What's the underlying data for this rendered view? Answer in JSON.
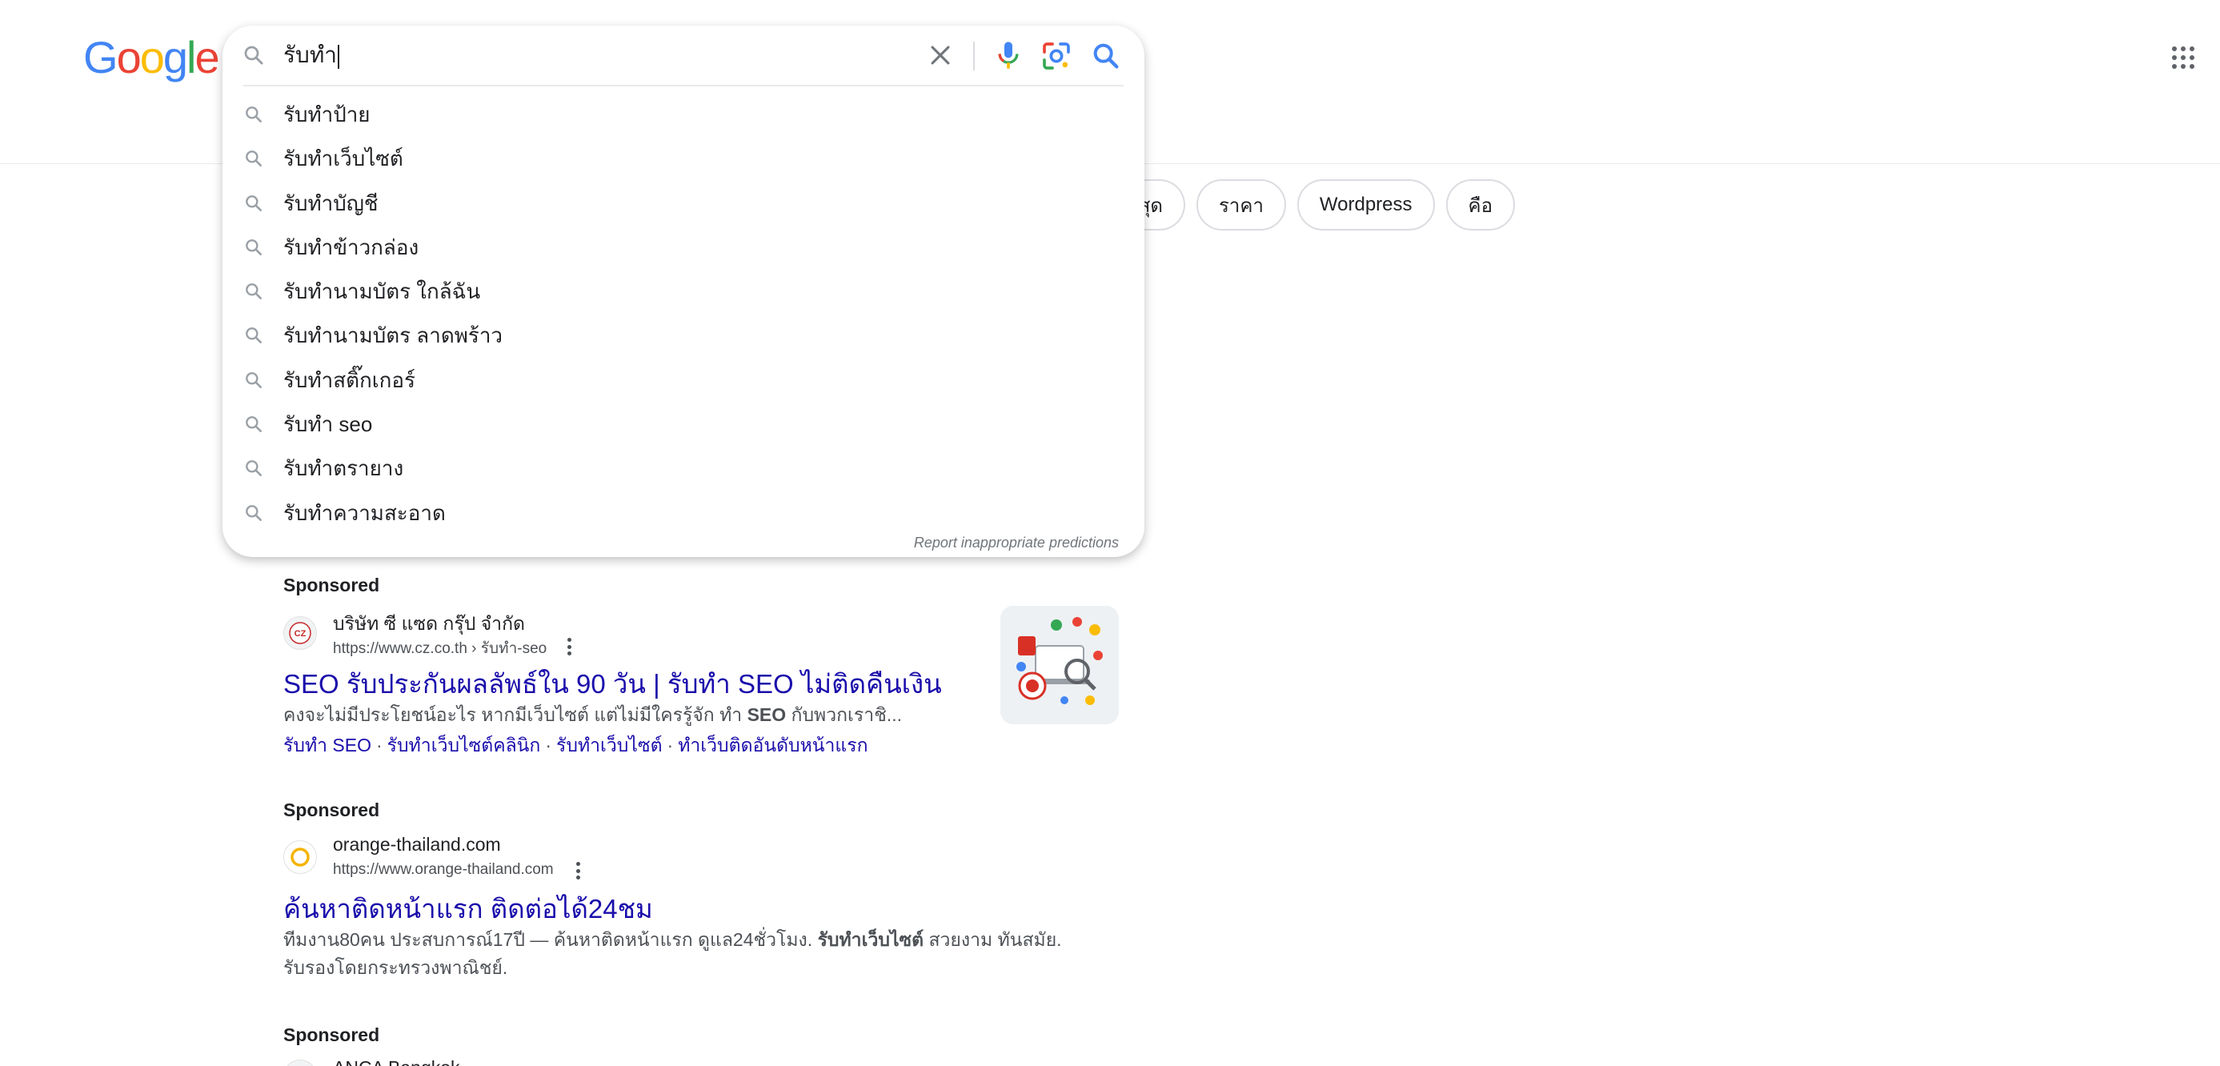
{
  "logo": {
    "text": "Google",
    "colors": [
      "#4285F4",
      "#EA4335",
      "#FBBC05",
      "#4285F4",
      "#34A853",
      "#EA4335"
    ]
  },
  "search": {
    "query": "รับทำ",
    "suggestions": [
      "รับทำป้าย",
      "รับทำเว็บไซต์",
      "รับทำบัญชี",
      "รับทำข้าวกล่อง",
      "รับทำนามบัตร ใกล้ฉัน",
      "รับทำนามบัตร ลาดพร้าว",
      "รับทำสติ๊กเกอร์",
      "รับทำ seo",
      "รับทำตรายาง",
      "รับทำความสะอาด"
    ],
    "report_text": "Report inappropriate predictions"
  },
  "chips": [
    "นสูงสุด",
    "ราคา",
    "Wordpress",
    "คือ"
  ],
  "ads": [
    {
      "sponsored_label": "Sponsored",
      "site_name": "บริษัท ซี แซด กรุ๊ป จำกัด",
      "url": "https://www.cz.co.th › รับทำ-seo",
      "favicon_text": "CZ",
      "title": "SEO รับประกันผลลัพธ์ใน 90 วัน | รับทำ SEO ไม่ติดคืนเงิน",
      "desc_pre": "คงจะไม่มีประโยชน์อะไร หากมีเว็บไซต์ แต่ไม่มีใครรู้จัก ทำ ",
      "desc_bold": "SEO",
      "desc_post": " กับพวกเราชิ...",
      "sitelinks": [
        "รับทำ SEO",
        "รับทำเว็บไซต์คลินิก",
        "รับทำเว็บไซต์",
        "ทำเว็บติดอันดับหน้าแรก"
      ],
      "sitelink_sep": "·"
    },
    {
      "sponsored_label": "Sponsored",
      "site_name": "orange-thailand.com",
      "url": "https://www.orange-thailand.com",
      "title": "ค้นหาติดหน้าแรก ติดต่อได้24ชม",
      "desc_line1_pre": "ทีมงาน80คน ประสบการณ์17ปี — ค้นหาติดหน้าแรก ดูแล24ชั่วโมง. ",
      "desc_line1_bold": "รับทำเว็บไซต์",
      "desc_line1_post": " สวยงาม ทันสมัย.",
      "desc_line2": "รับรองโดยกระทรวงพาณิชย์."
    },
    {
      "sponsored_label": "Sponsored",
      "site_name": "ANCA Bangkok"
    }
  ],
  "colors": {
    "link": "#1a0dab",
    "mic_blue": "#4285F4",
    "mic_red": "#EA4335"
  }
}
